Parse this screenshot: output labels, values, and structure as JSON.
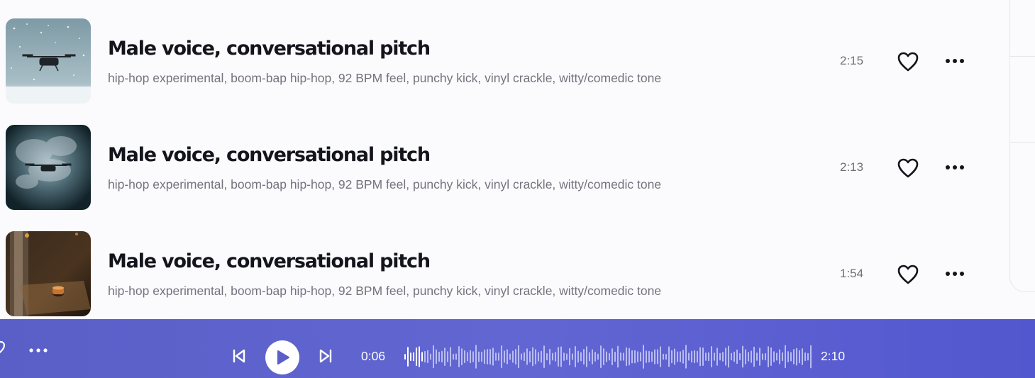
{
  "tracks": [
    {
      "title": "Male voice, conversational pitch",
      "tags": "hip-hop experimental, boom-bap hip-hop, 92 BPM feel, punchy kick, vinyl crackle, witty/comedic tone",
      "duration": "2:15",
      "thumbnail": "drone-in-snow"
    },
    {
      "title": "Male voice, conversational pitch",
      "tags": "hip-hop experimental, boom-bap hip-hop, 92 BPM feel, punchy kick, vinyl crackle, witty/comedic tone",
      "duration": "2:13",
      "thumbnail": "drone-in-smoke"
    },
    {
      "title": "Male voice, conversational pitch",
      "tags": "hip-hop experimental, boom-bap hip-hop, 92 BPM feel, punchy kick, vinyl crackle, witty/comedic tone",
      "duration": "1:54",
      "thumbnail": "cup-by-window"
    }
  ],
  "player": {
    "elapsed": "0:06",
    "total": "2:10",
    "progress_fraction": 0.046,
    "icons": [
      "heart-icon",
      "more-icon",
      "previous-icon",
      "play-icon",
      "next-icon"
    ]
  },
  "colors": {
    "player_gradient_start": "#5a5fc7",
    "player_gradient_end": "#5357cf",
    "played_wave": "#ffffff",
    "unplayed_wave": "#b9bcf2",
    "title": "#14141c",
    "meta": "#73737e"
  }
}
